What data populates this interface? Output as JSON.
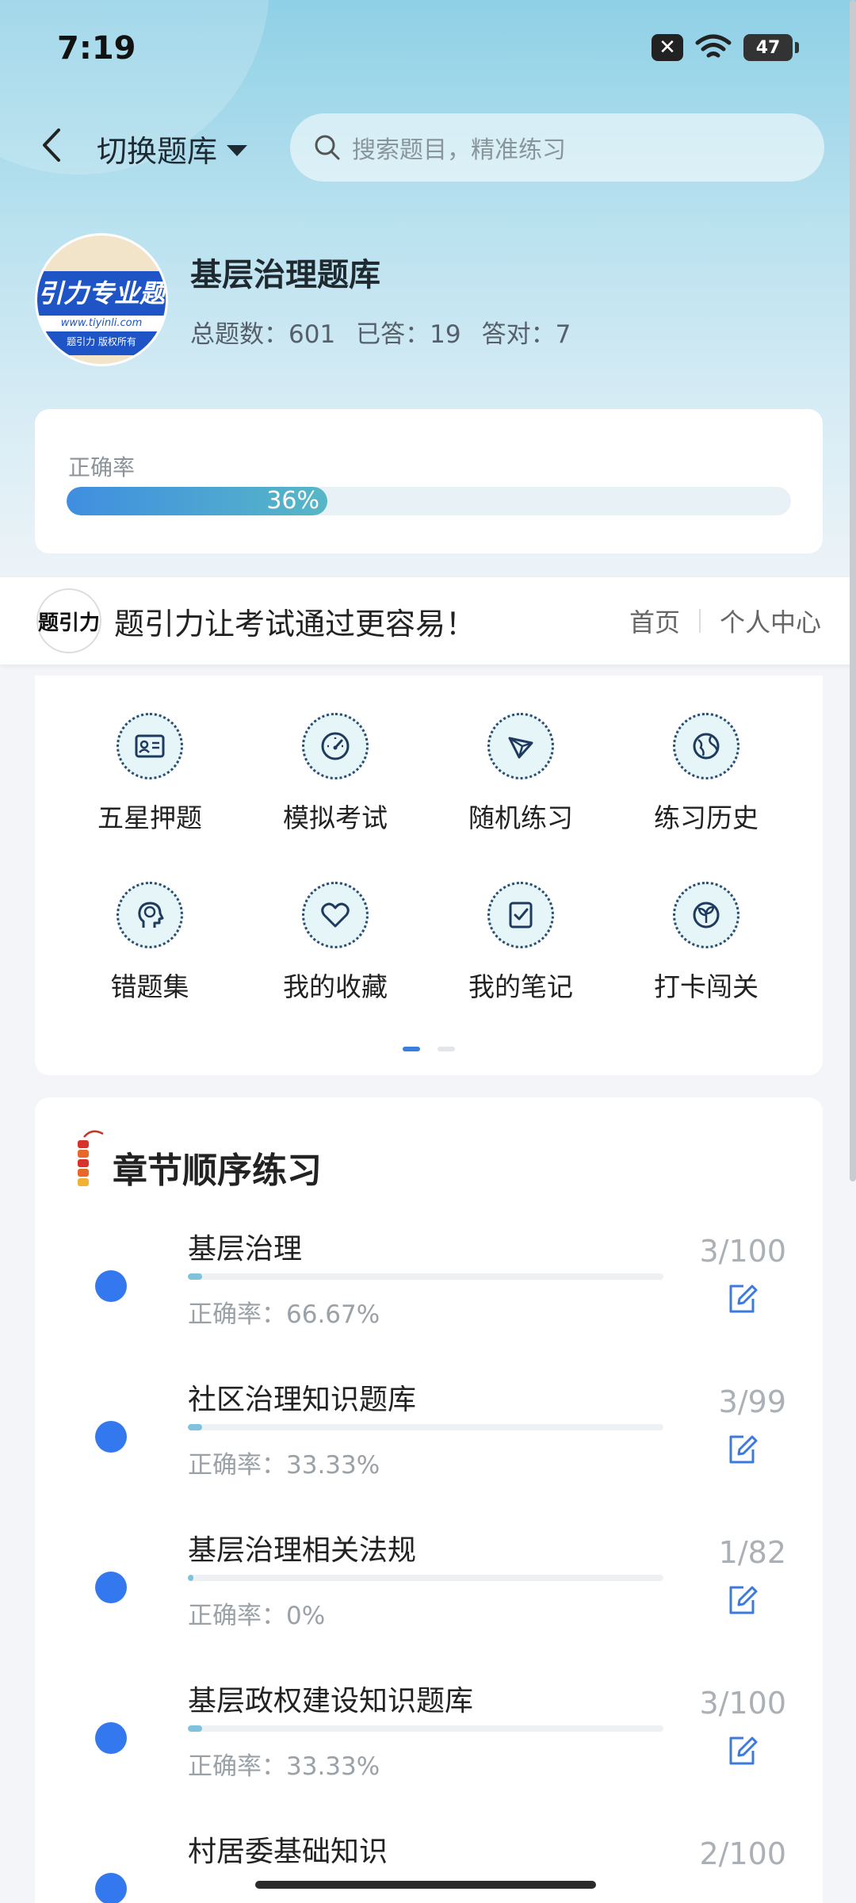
{
  "status": {
    "time": "7:19",
    "battery": "47"
  },
  "header": {
    "switch_label": "切换题库",
    "search_placeholder": "搜索题目，精准练习"
  },
  "bank": {
    "logo_band": "引力专业题",
    "logo_url": "www.tiyinli.com",
    "logo_copy": "题引力 版权所有",
    "title": "基层治理题库",
    "total": "总题数：601",
    "answered": "已答：19",
    "correct": "答对：7"
  },
  "accuracy": {
    "label": "正确率",
    "value_text": "36%",
    "value": 0.36
  },
  "banner": {
    "logo_text": "题引力",
    "slogan": "题引力让考试通过更容易！",
    "home_link": "首页",
    "profile_link": "个人中心"
  },
  "menu": [
    {
      "label": "五星押题",
      "icon": "id-card-icon"
    },
    {
      "label": "模拟考试",
      "icon": "speedometer-icon"
    },
    {
      "label": "随机练习",
      "icon": "random-icon"
    },
    {
      "label": "练习历史",
      "icon": "globe-icon"
    },
    {
      "label": "错题集",
      "icon": "brain-head-icon"
    },
    {
      "label": "我的收藏",
      "icon": "heart-icon"
    },
    {
      "label": "我的笔记",
      "icon": "note-check-icon"
    },
    {
      "label": "打卡闯关",
      "icon": "sprout-icon"
    }
  ],
  "chapters": {
    "title": "章节顺序练习",
    "items": [
      {
        "name": "基层治理",
        "rate": "正确率：66.67%",
        "count": "3/100",
        "progress": 0.03
      },
      {
        "name": "社区治理知识题库",
        "rate": "正确率：33.33%",
        "count": "3/99",
        "progress": 0.03
      },
      {
        "name": "基层治理相关法规",
        "rate": "正确率：0%",
        "count": "1/82",
        "progress": 0.012
      },
      {
        "name": "基层政权建设知识题库",
        "rate": "正确率：33.33%",
        "count": "3/100",
        "progress": 0.03
      },
      {
        "name": "村居委基础知识",
        "rate": "",
        "count": "2/100",
        "progress": 0.02
      }
    ]
  },
  "colors": {
    "accent": "#3478f0",
    "bar": "#4a9fd8"
  }
}
